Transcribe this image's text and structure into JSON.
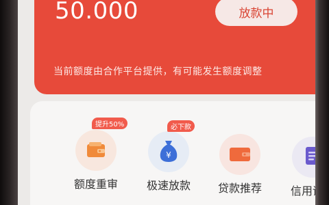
{
  "banner": {
    "amount": "50.000",
    "status_button": "放款中",
    "notice": "当前额度由合作平台提供，有可能发生额度调整"
  },
  "features": [
    {
      "label": "额度重审",
      "badge": "提升50%",
      "icon": "wallet-icon"
    },
    {
      "label": "极速放款",
      "badge": "必下款",
      "icon": "money-bag-icon"
    },
    {
      "label": "贷款推荐",
      "icon": "wallet-icon"
    },
    {
      "label": "信用评估",
      "icon": "document-icon"
    }
  ],
  "colors": {
    "banner": "#e74a3a",
    "accent_orange": "#f08a3a",
    "accent_blue": "#3d6fd8",
    "accent_purple": "#6a5acd"
  }
}
